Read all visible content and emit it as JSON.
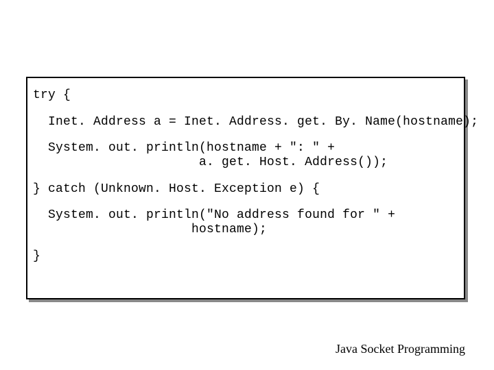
{
  "code": {
    "line1": "try {",
    "line2": "  Inet. Address a = Inet. Address. get. By. Name(hostname);",
    "line3": "  System. out. println(hostname + \": \" +",
    "line4": "                      a. get. Host. Address());",
    "line5": "} catch (Unknown. Host. Exception e) {",
    "line6": "  System. out. println(\"No address found for \" +",
    "line7": "                     hostname);",
    "line8": "}"
  },
  "footer": "Java Socket Programming"
}
